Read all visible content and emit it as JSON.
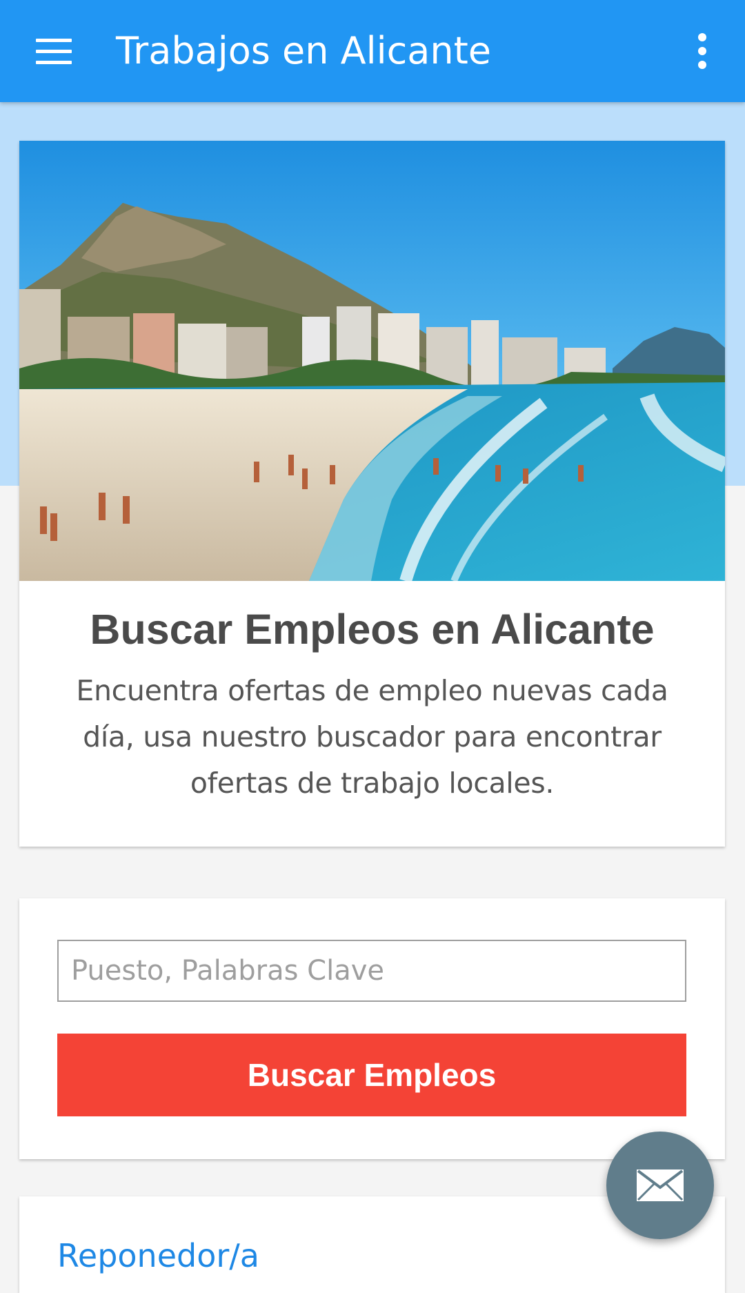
{
  "app_bar": {
    "title": "Trabajos en Alicante",
    "menu_icon": "hamburger-menu-icon",
    "overflow_icon": "more-vert-icon",
    "color": "#2196f3"
  },
  "hero": {
    "image_alt": "Playa de Alicante con el castillo de Santa Bárbara",
    "heading": "Buscar Empleos en Alicante",
    "description": "Encuentra ofertas de empleo nuevas cada día, usa nuestro buscador para encontrar ofertas de trabajo locales."
  },
  "search": {
    "placeholder": "Puesto, Palabras Clave",
    "value": "",
    "button_label": "Buscar Empleos",
    "button_color": "#f44336"
  },
  "jobs": [
    {
      "title": "Reponedor/a"
    }
  ],
  "fab": {
    "icon": "mail-icon",
    "color": "#607d8b"
  }
}
